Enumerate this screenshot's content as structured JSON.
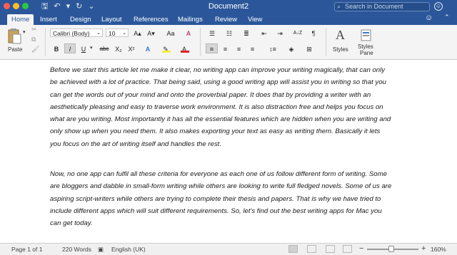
{
  "window": {
    "title": "Document2",
    "search_placeholder": "Search in Document",
    "traffic_colors": [
      "#ff5f57",
      "#ffbd2e",
      "#28c840"
    ]
  },
  "qat": {
    "save": "🖫",
    "save_icon": "save-icon",
    "undo": "↶",
    "undo_icon": "undo-icon",
    "undo_menu": "▾",
    "redo": "↻",
    "redo_icon": "redo-icon",
    "more": "⌄"
  },
  "tabs": [
    {
      "label": "Home"
    },
    {
      "label": "Insert"
    },
    {
      "label": "Design"
    },
    {
      "label": "Layout"
    },
    {
      "label": "References"
    },
    {
      "label": "Mailings"
    },
    {
      "label": "Review"
    },
    {
      "label": "View"
    }
  ],
  "clipboard": {
    "paste_label": "Paste"
  },
  "font": {
    "name": "Calibri (Body)",
    "size": "10",
    "grow": "A▴",
    "shrink": "A▾",
    "case": "Aa",
    "clear": "A",
    "bold": "B",
    "italic": "I",
    "underline": "U",
    "strikethrough": "abc",
    "subscript": "X₂",
    "superscript": "X²",
    "effects": "A",
    "font_color": "A",
    "highlight_color": "#f6ee3b",
    "font_color_value": "#e02020"
  },
  "paragraph": {
    "sort": "A↓Z",
    "show_marks": "¶"
  },
  "styles": {
    "styles_label": "Styles",
    "pane_label_1": "Styles",
    "pane_label_2": "Pane"
  },
  "document": {
    "paragraphs": [
      "Before we start this article let me make it clear, no writing app can improve your writing magically, that can only be achieved with a lot of practice. That being said, using a good writing app will assist you in writing so that you can get the words out of your mind and onto the proverbial paper. It does that by providing a writer with an aesthetically pleasing and easy to traverse work environment. It is also distraction free and helps you focus on what are you writing. Most importantly it has all the essential features which are hidden when you are writing and only show up when you need them. It also makes exporting your text as easy as writing them. Basically it lets you focus on the art of writing itself and handles the rest.",
      "Now, no one app can fulfil all these criteria for everyone as each one of us follow different form of writing. Some are bloggers and dabble in small-form writing while others are looking to write full fledged novels. Some of us are aspiring script-writers while others are trying to complete their thesis and papers. That is why we have tried to include different apps which will suit different requirements. So, let's find out the best writing apps for Mac you can get today."
    ]
  },
  "status": {
    "page": "Page 1 of 1",
    "words": "220 Words",
    "language": "English (UK)",
    "zoom": "160%",
    "zoom_minus": "−",
    "zoom_plus": "+",
    "zoom_level": 0.47
  }
}
